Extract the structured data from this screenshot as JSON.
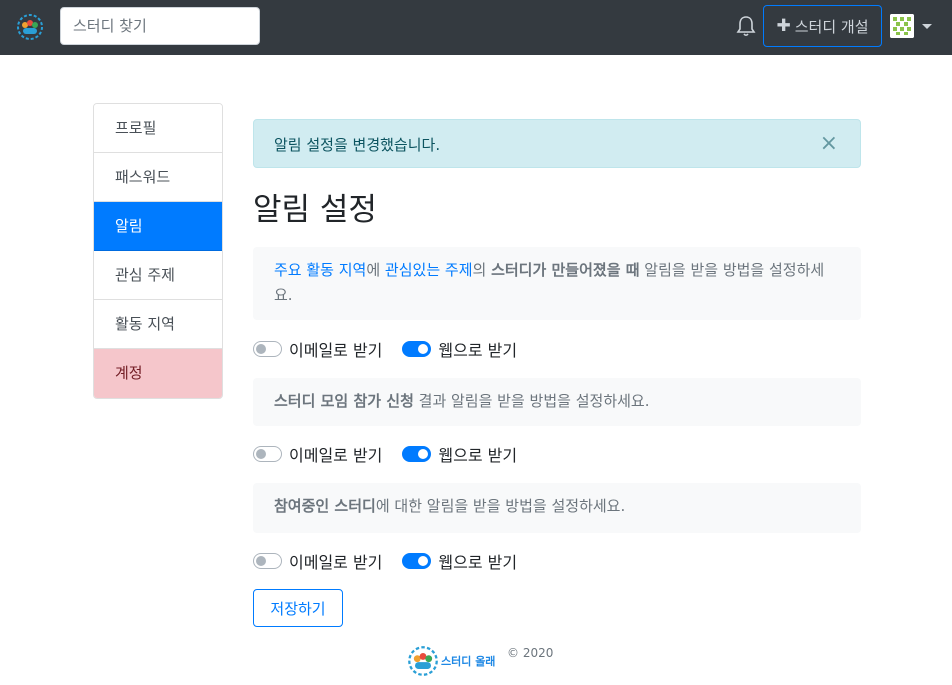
{
  "navbar": {
    "search_placeholder": "스터디 찾기",
    "create_label": "스터디 개설",
    "icons": [
      "logo-icon",
      "bell-icon",
      "plus-icon",
      "avatar",
      "caret-down-icon"
    ]
  },
  "sidebar": {
    "items": [
      {
        "label": "프로필",
        "state": "default"
      },
      {
        "label": "패스워드",
        "state": "default"
      },
      {
        "label": "알림",
        "state": "active"
      },
      {
        "label": "관심 주제",
        "state": "default"
      },
      {
        "label": "활동 지역",
        "state": "default"
      },
      {
        "label": "계정",
        "state": "danger"
      }
    ]
  },
  "alert": {
    "message": "알림 설정을 변경했습니다.",
    "close": "×"
  },
  "title": "알림 설정",
  "sections": [
    {
      "parts": [
        {
          "text": "주요 활동 지역",
          "style": "link"
        },
        {
          "text": "에 ",
          "style": "plain"
        },
        {
          "text": "관심있는 주제",
          "style": "link"
        },
        {
          "text": "의 ",
          "style": "plain"
        },
        {
          "text": "스터디가 만들어졌을 때",
          "style": "bold"
        },
        {
          "text": " 알림을 받을 방법을 설정하세요.",
          "style": "plain"
        }
      ],
      "email_label": "이메일로 받기",
      "email_on": false,
      "web_label": "웹으로 받기",
      "web_on": true
    },
    {
      "parts": [
        {
          "text": "스터디 모임 참가 신청",
          "style": "bold"
        },
        {
          "text": " 결과 알림을 받을 방법을 설정하세요.",
          "style": "plain"
        }
      ],
      "email_label": "이메일로 받기",
      "email_on": false,
      "web_label": "웹으로 받기",
      "web_on": true
    },
    {
      "parts": [
        {
          "text": "참여중인 스터디",
          "style": "bold"
        },
        {
          "text": "에 대한 알림을 받을 방법을 설정하세요.",
          "style": "plain"
        }
      ],
      "email_label": "이메일로 받기",
      "email_on": false,
      "web_label": "웹으로 받기",
      "web_on": true
    }
  ],
  "save_label": "저장하기",
  "footer": {
    "logo_text": "스터디 올래",
    "copyright": "© 2020"
  },
  "colors": {
    "navbar": "#343a40",
    "primary": "#007bff",
    "alert_bg": "#d1ecf1",
    "danger_bg": "#f5c6cb"
  }
}
